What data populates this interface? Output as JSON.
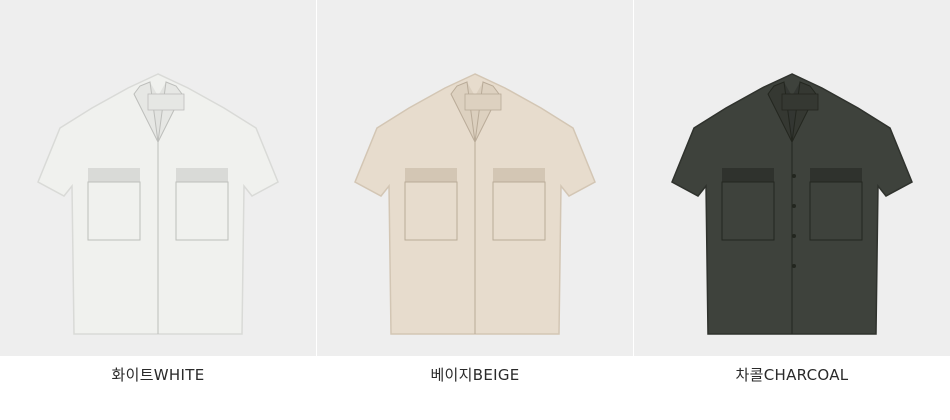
{
  "products": [
    {
      "label": "화이트WHITE",
      "shirt_name": "white-shirt-image",
      "fill": "#f0f1ee",
      "shade": "#d9dad7",
      "line": "#bdbebb",
      "bg": "#eeeeee"
    },
    {
      "label": "베이지BEIGE",
      "shirt_name": "beige-shirt-image",
      "fill": "#e7dccd",
      "shade": "#d3c6b4",
      "line": "#b9ab98",
      "bg": "#eeeeee"
    },
    {
      "label": "차콜CHARCOAL",
      "shirt_name": "charcoal-shirt-image",
      "fill": "#3e423c",
      "shade": "#2f322d",
      "line": "#23261f",
      "bg": "#eeeeee"
    }
  ]
}
